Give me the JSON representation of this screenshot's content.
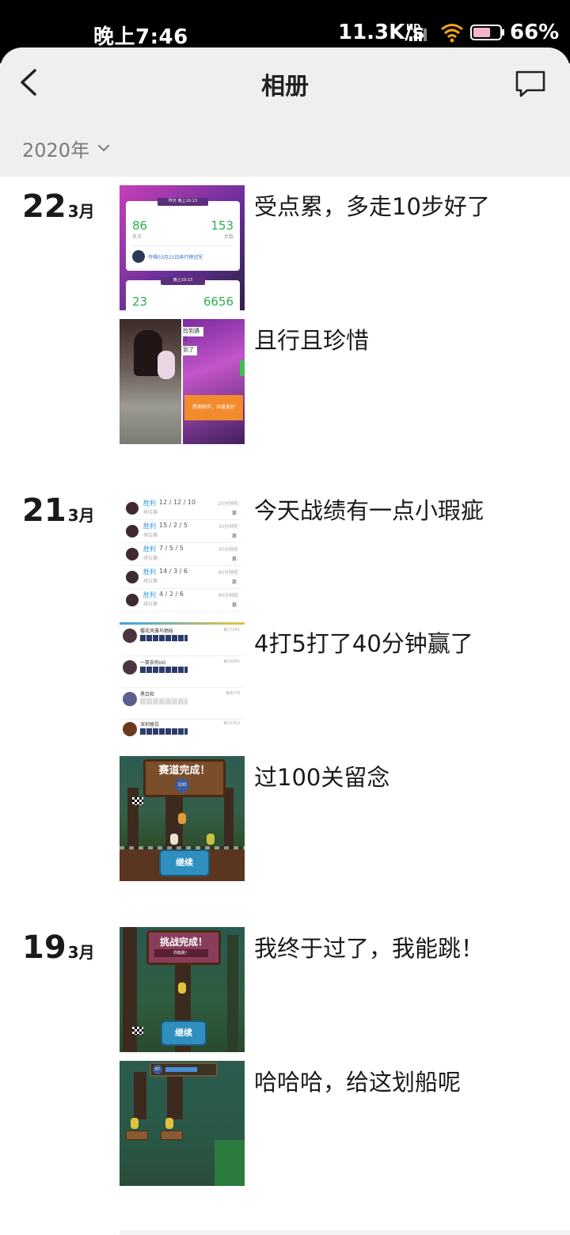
{
  "status_bar": {
    "time": "晚上7:46",
    "network_speed": "11.3K/s",
    "hd_label": "HD",
    "battery_percent": "66%",
    "battery_level": 0.66
  },
  "header": {
    "title": "相册",
    "back_icon": "chevron-left-icon",
    "action_icon": "comment-icon"
  },
  "year_filter": {
    "label": "2020年",
    "icon": "chevron-down-icon"
  },
  "groups": [
    {
      "day": "22",
      "month": "3月",
      "posts": [
        {
          "caption": "受点累，多走10步好了",
          "thumb": {
            "header": "昨天 晚上10:13",
            "count_left": "86",
            "count_right": "153",
            "label_left": "名次",
            "label_right": "步数",
            "rank_text": "夺得03月21日排行榜冠军",
            "header2": "晚上10:13",
            "count_left2": "23",
            "count_right2": "6656"
          }
        },
        {
          "caption": "且行且珍惜",
          "thumb": {
            "bubble1": "捡到遇上",
            "bubble2": "到了",
            "orange_text": "感谢陪伴，共度美好"
          }
        }
      ]
    },
    {
      "day": "21",
      "month": "3月",
      "posts": [
        {
          "caption": "今天战绩有一点小瑕疵",
          "thumb": {
            "rows": [
              {
                "result": "胜利",
                "kda": "12 / 12 / 10",
                "mode": "排位赛",
                "time": "20分钟前",
                "tag": "赢"
              },
              {
                "result": "胜利",
                "kda": "15 / 2 / 5",
                "mode": "排位赛",
                "time": "30分钟前",
                "tag": "赢"
              },
              {
                "result": "胜利",
                "kda": "7 / 5 / 5",
                "mode": "排位赛",
                "time": "30分钟前",
                "tag": "赢"
              },
              {
                "result": "胜利",
                "kda": "14 / 3 / 6",
                "mode": "排位赛",
                "time": "40分钟前",
                "tag": "赢"
              },
              {
                "result": "胜利",
                "kda": "4 / 2 / 6",
                "mode": "排位赛",
                "time": "40分钟前",
                "tag": "赢"
              }
            ]
          }
        },
        {
          "caption": "4打5打了40分钟赢了",
          "thumb": {
            "players": [
              {
                "name": "樱花风雅鸟栖枝",
                "score": "第17681"
              },
              {
                "name": "一笑奈何oO",
                "score": "第16685"
              },
              {
                "name": "黑白软",
                "score": "第8078"
              },
              {
                "name": "深圳留白",
                "score": "第12352"
              }
            ]
          }
        },
        {
          "caption": "过100关留念",
          "thumb": {
            "sign": "赛道完成！",
            "badge": "100",
            "button": "继续"
          }
        }
      ]
    },
    {
      "day": "19",
      "month": "3月",
      "posts": [
        {
          "caption": "我终于过了，我能跳！",
          "thumb": {
            "sign": "挑战完成！",
            "sub": "你能跳！",
            "button": "继续"
          }
        },
        {
          "caption": "哈哈哈，给这划船呢",
          "thumb": {
            "level": "87"
          }
        }
      ]
    }
  ]
}
